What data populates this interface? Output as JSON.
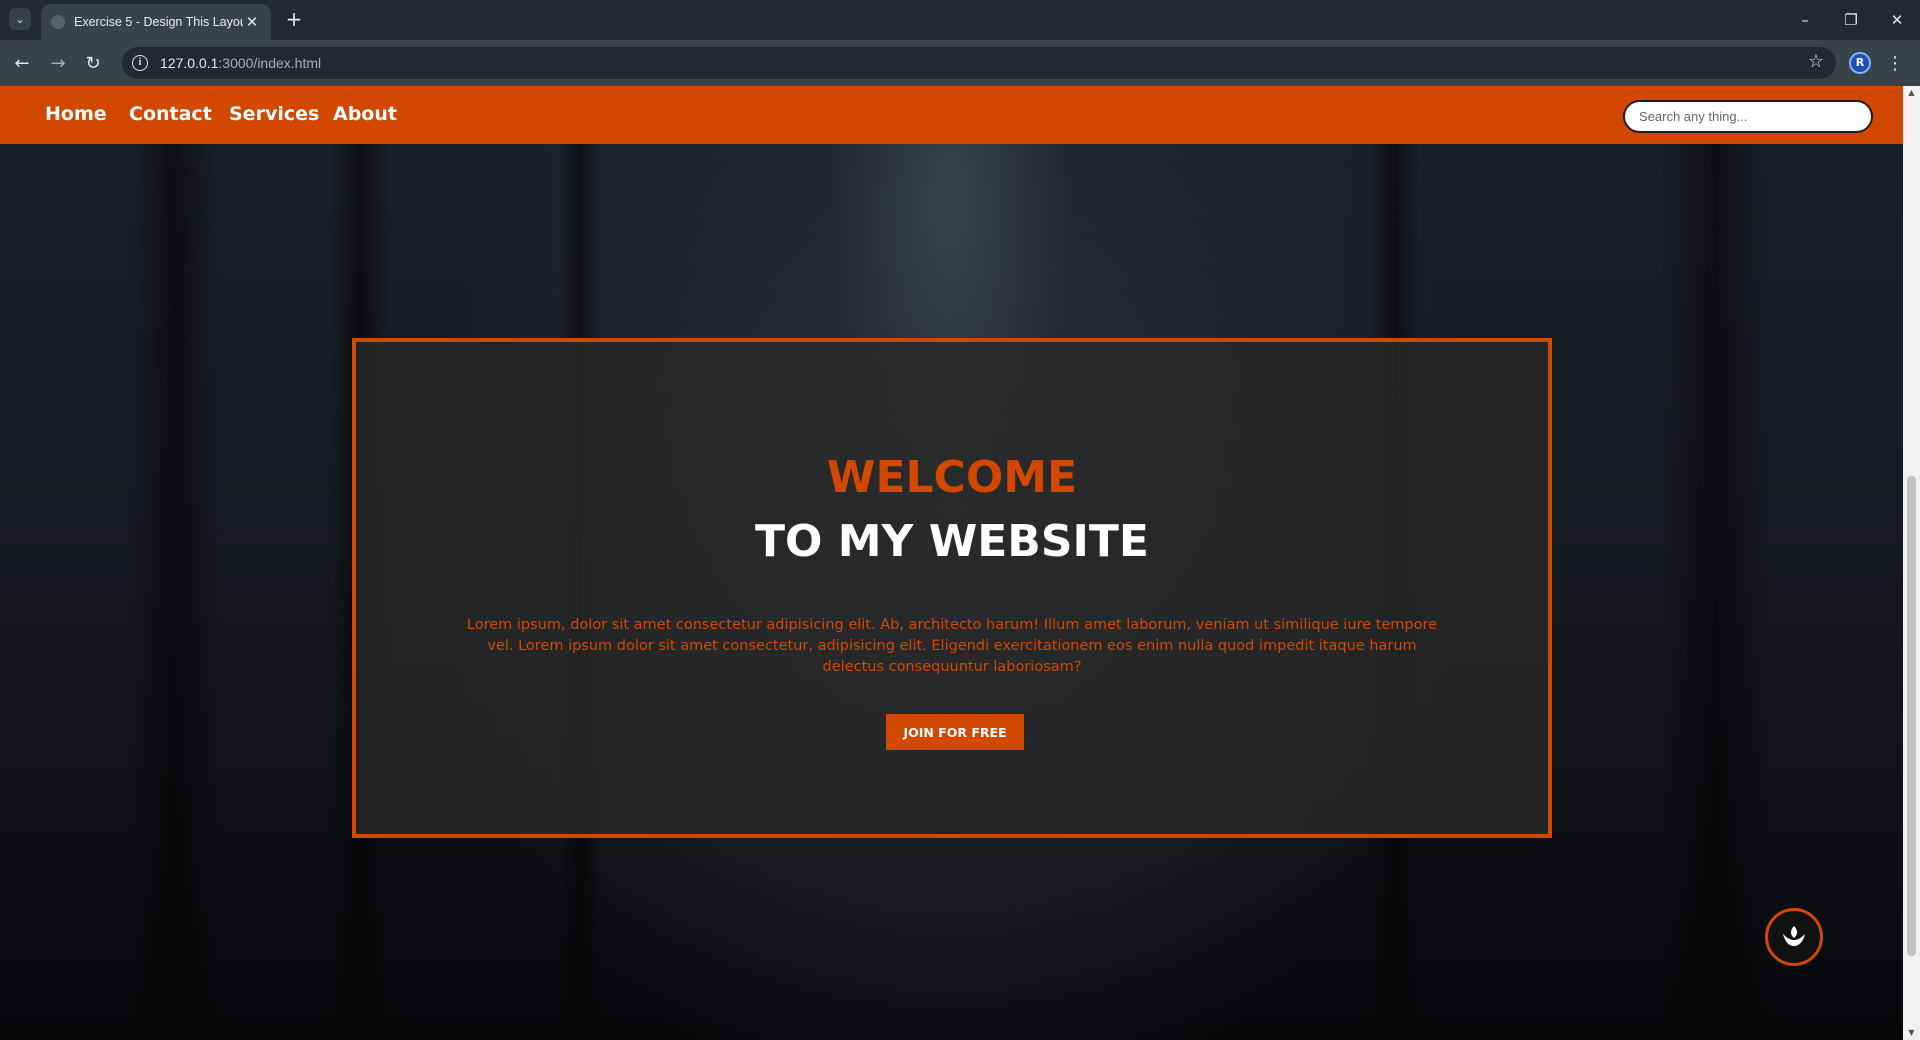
{
  "browser": {
    "tab_title": "Exercise 5 - Design This Layout",
    "url_host": "127.0.0.1",
    "url_rest": ":3000/index.html",
    "icons": [
      "tab-list-icon",
      "close-icon",
      "new-tab-icon",
      "minimize-icon",
      "restore-icon",
      "window-close-icon",
      "back-icon",
      "forward-icon",
      "reload-icon",
      "site-info-icon",
      "bookmark-star-icon",
      "profile-icon",
      "menu-icon"
    ],
    "profile_initial": "R"
  },
  "site": {
    "nav": {
      "home": "Home",
      "contact": "Contact",
      "services": "Services",
      "about": "About"
    },
    "search": {
      "placeholder": "Search any thing..."
    },
    "hero": {
      "welcome": "WELCOME",
      "subtitle": "TO MY WEBSITE",
      "text": "Lorem ipsum, dolor sit amet consectetur adipisicing elit. Ab, architecto harum! Illum amet laborum, veniam ut similique iure tempore vel. Lorem ipsum dolor sit amet consectetur, adipisicing elit. Eligendi exercitationem eos enim nulla quod impedit itaque harum delectus consequuntur laboriosam?",
      "button": "JOIN FOR FREE"
    },
    "widget_icon": "lotus-icon"
  },
  "colors": {
    "accent": "#d24800",
    "nav_bg": "#d24800",
    "hero_bg": "#282828",
    "white": "#ffffff"
  }
}
